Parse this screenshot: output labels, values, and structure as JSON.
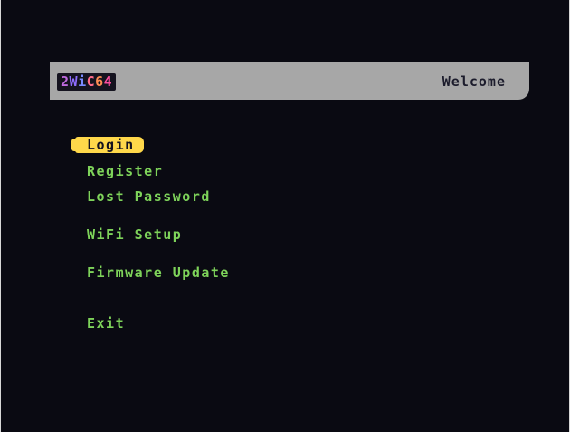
{
  "header": {
    "logo_parts": [
      "2",
      "W",
      "i",
      "C",
      "6",
      "4"
    ],
    "title": "Welcome"
  },
  "menu": {
    "items": [
      {
        "label": "Login",
        "selected": true
      },
      {
        "label": "Register",
        "selected": false
      },
      {
        "label": "Lost Password",
        "selected": false
      },
      {
        "label": "WiFi Setup",
        "selected": false
      },
      {
        "label": "Firmware Update",
        "selected": false
      },
      {
        "label": "Exit",
        "selected": false
      }
    ]
  },
  "colors": {
    "background": "#0a0a12",
    "header_bar": "#a7a7a7",
    "menu_text": "#7ed35a",
    "selected_highlight": "#ffd84a"
  }
}
